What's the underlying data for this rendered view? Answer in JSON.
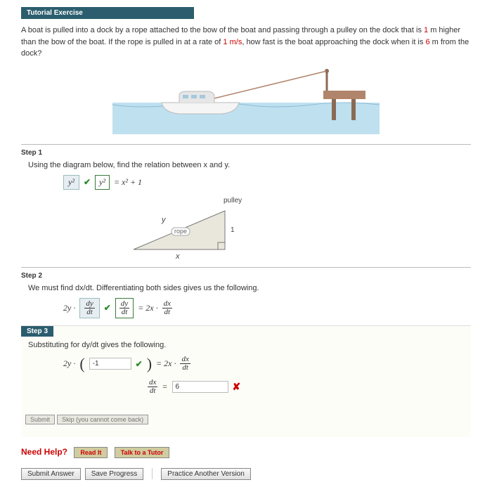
{
  "header": {
    "title": "Tutorial Exercise"
  },
  "question": {
    "prefix": "A boat is pulled into a dock by a rope attached to the bow of the boat and passing through a pulley on the dock that is ",
    "val1": "1",
    "mid1": " m higher than the bow of the boat. If the rope is pulled in at a rate of ",
    "val2": "1 m/s",
    "mid2": ", how fast is the boat approaching the dock when it is ",
    "val3": "6",
    "suffix": " m from the dock?"
  },
  "step1": {
    "title": "Step 1",
    "text": "Using the diagram below, find the relation between x and y.",
    "ans1": "y²",
    "g1": "y²",
    "rhs": " = x² + 1",
    "labels": {
      "pulley": "pulley",
      "rope": "rope",
      "one": "1",
      "x": "x",
      "y": "y"
    }
  },
  "step2": {
    "title": "Step 2",
    "text": "We must find dx/dt. Differentiating both sides gives us the following.",
    "pre": "2y ·",
    "ans_top": "dy",
    "ans_bot": "dt",
    "g_top": "dy",
    "g_bot": "dt",
    "rhs_pre": " = 2x · ",
    "rhs_top": "dx",
    "rhs_bot": "dt"
  },
  "step3": {
    "title": "Step 3",
    "text": "Substituting for dy/dt gives the following.",
    "pre": "2y ·",
    "val1": "-1",
    "rhs_pre": " = 2x · ",
    "rhs_top": "dx",
    "rhs_bot": "dt",
    "line2_top": "dx",
    "line2_bot": "dt",
    "val2": "6",
    "btn_submit": "Submit",
    "btn_skip": "Skip (you cannot come back)"
  },
  "help": {
    "label": "Need Help?",
    "read": "Read It",
    "tutor": "Talk to a Tutor"
  },
  "footer": {
    "submit": "Submit Answer",
    "save": "Save Progress",
    "practice": "Practice Another Version"
  }
}
